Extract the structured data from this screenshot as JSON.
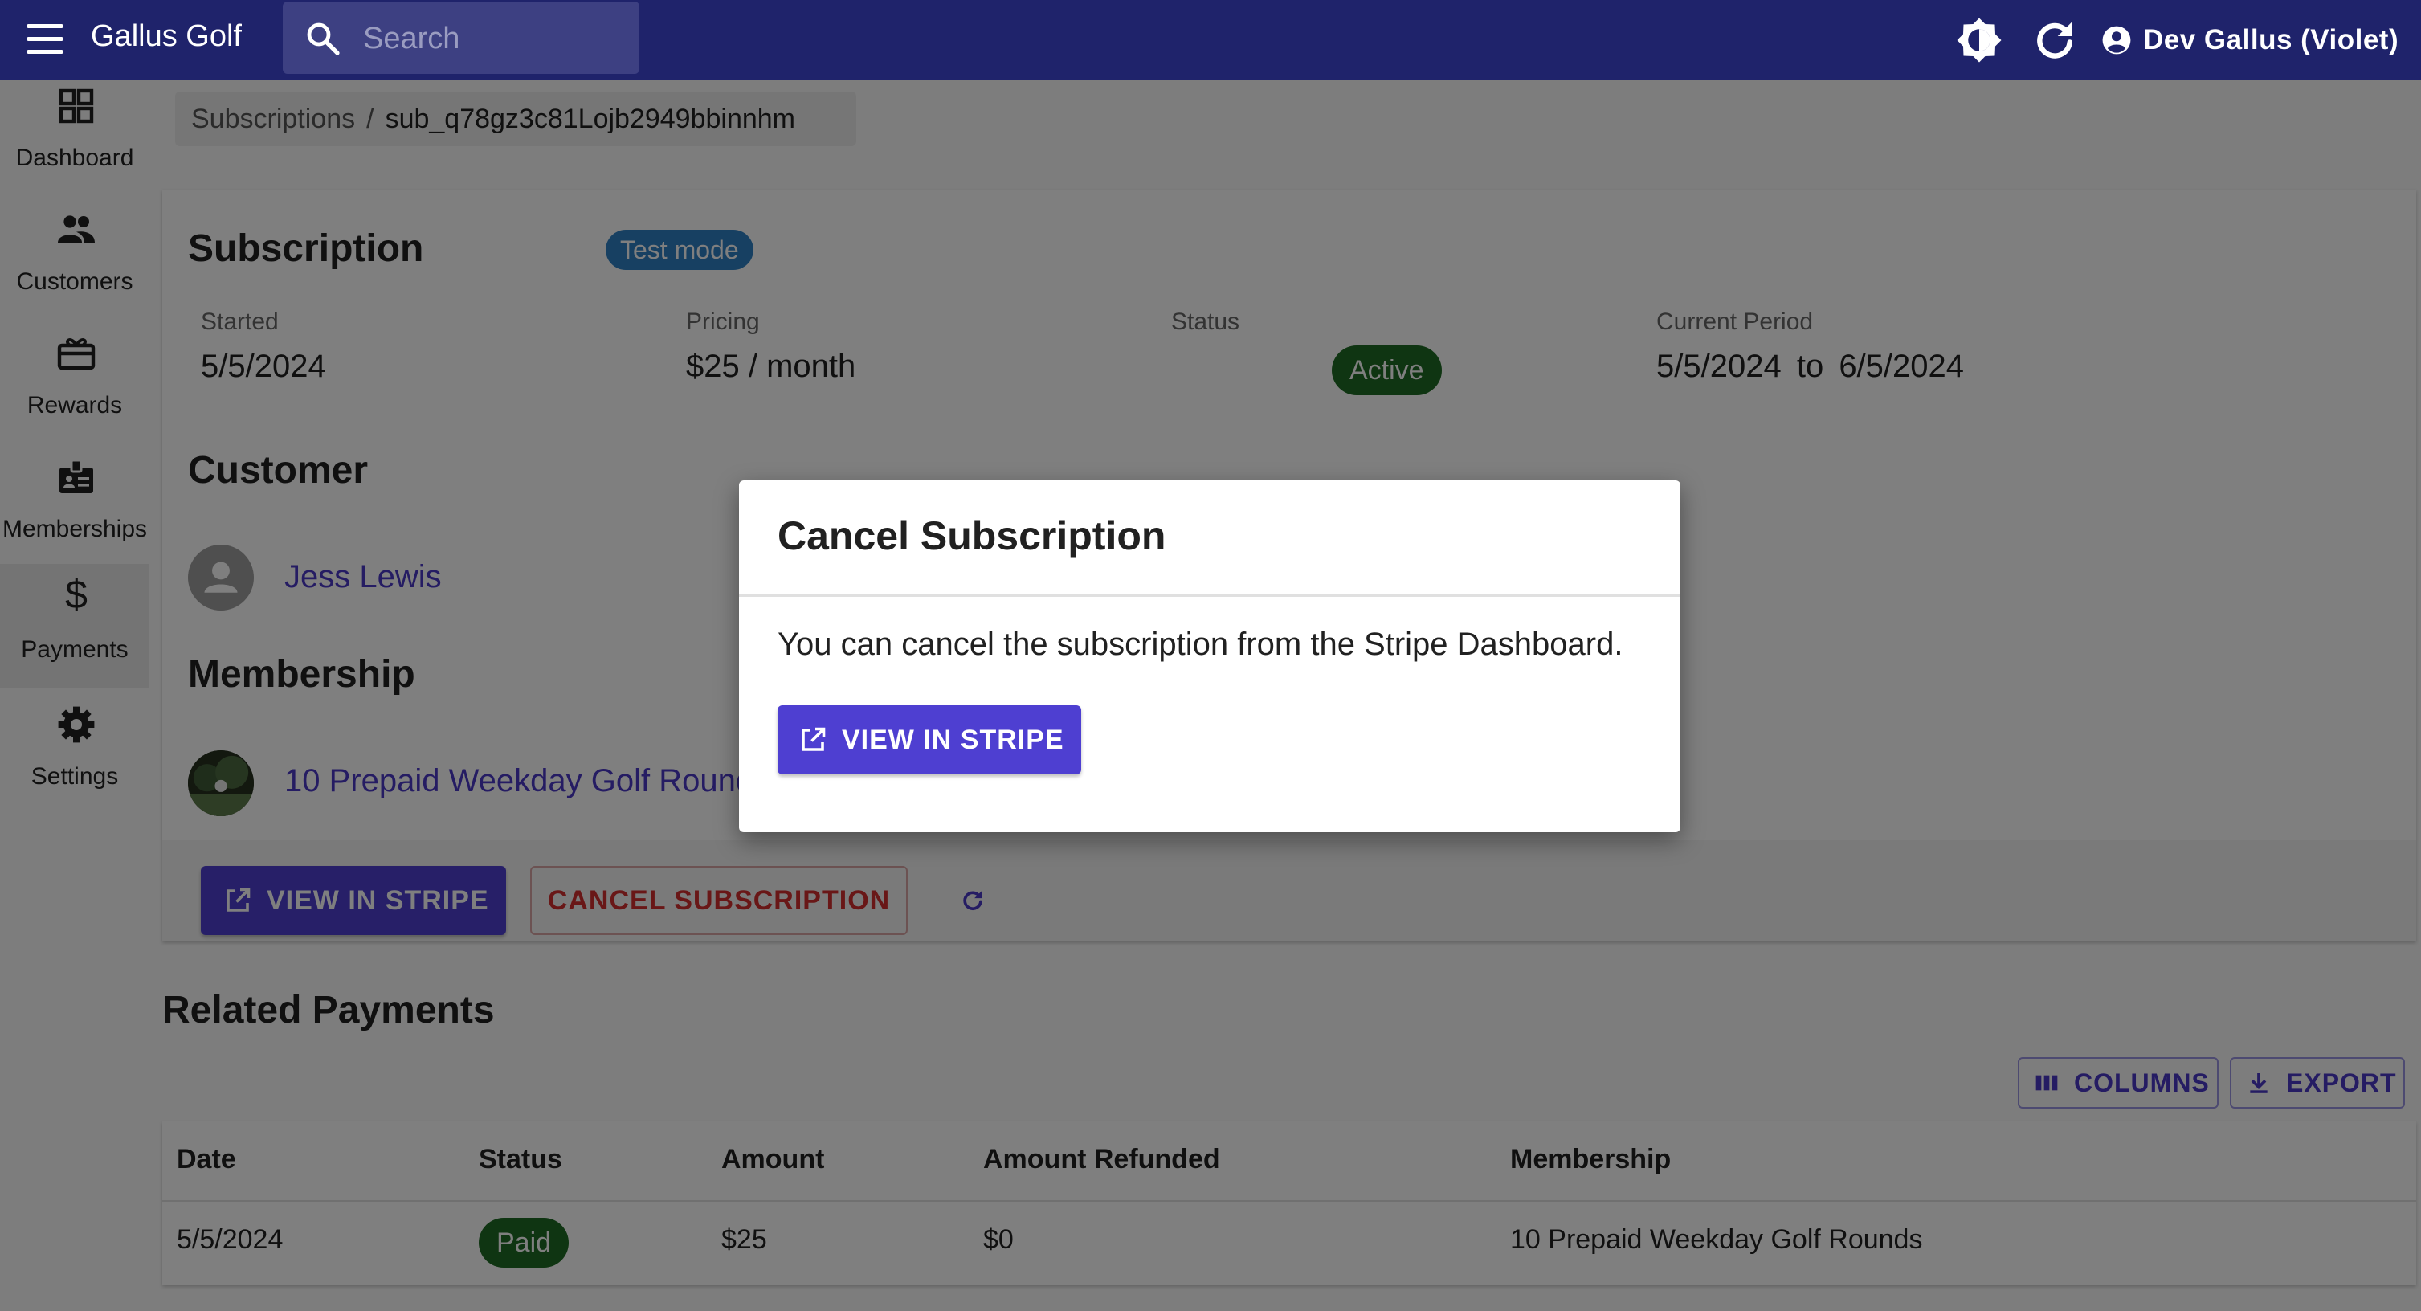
{
  "appbar": {
    "title": "Gallus Golf",
    "search_placeholder": "Search",
    "user_name": "Dev Gallus (Violet)"
  },
  "sidebar": {
    "items": [
      {
        "label": "Dashboard",
        "icon": "dashboard-icon"
      },
      {
        "label": "Customers",
        "icon": "people-icon"
      },
      {
        "label": "Rewards",
        "icon": "card-giftcard-icon"
      },
      {
        "label": "Memberships",
        "icon": "badge-icon"
      },
      {
        "label": "Payments",
        "icon": "dollar-icon",
        "active": true
      },
      {
        "label": "Settings",
        "icon": "gear-icon"
      }
    ]
  },
  "breadcrumb": {
    "parent": "Subscriptions",
    "separator": "/",
    "current": "sub_q78gz3c81Lojb2949bbinnhm"
  },
  "subscription": {
    "title": "Subscription",
    "mode_badge": "Test mode",
    "fields": {
      "started_label": "Started",
      "started_value": "5/5/2024",
      "pricing_label": "Pricing",
      "pricing_value": "$25 / month",
      "status_label": "Status",
      "status_value": "Active",
      "period_label": "Current Period",
      "period_start": "5/5/2024",
      "period_to": "to",
      "period_end": "6/5/2024"
    },
    "customer_heading": "Customer",
    "customer_name": "Jess Lewis",
    "membership_heading": "Membership",
    "membership_name": "10 Prepaid Weekday Golf Rounds",
    "actions": {
      "view_stripe": "VIEW IN STRIPE",
      "cancel": "CANCEL SUBSCRIPTION"
    }
  },
  "related_payments": {
    "title": "Related Payments",
    "columns_button": "COLUMNS",
    "export_button": "EXPORT",
    "headers": [
      "Date",
      "Status",
      "Amount",
      "Amount Refunded",
      "Membership"
    ],
    "rows": [
      {
        "date": "5/5/2024",
        "status": "Paid",
        "amount": "$25",
        "refunded": "$0",
        "membership": "10 Prepaid Weekday Golf Rounds"
      }
    ]
  },
  "dialog": {
    "title": "Cancel Subscription",
    "body": "You can cancel the subscription from the Stripe Dashboard.",
    "button": "VIEW IN STRIPE"
  },
  "colors": {
    "appbar": "#1f236b",
    "primary": "#4e3fd1",
    "success": "#1f6b24",
    "error": "#d32f2f",
    "info": "#2f81c4"
  }
}
